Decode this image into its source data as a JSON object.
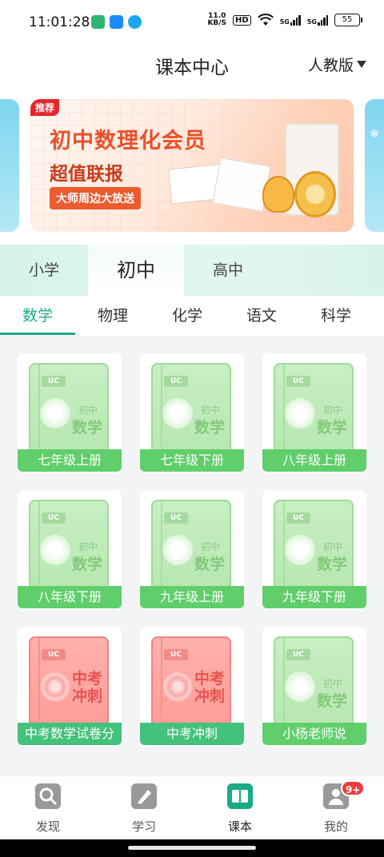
{
  "status_bar": {
    "time": "11:01:28",
    "net_speed_value": "11.0",
    "net_speed_unit": "KB/S",
    "hd": "HD",
    "sig1": "5G",
    "sig2": "5G",
    "battery": "55"
  },
  "header": {
    "title": "课本中心",
    "edition": "人教版"
  },
  "banner": {
    "tag": "推荐",
    "title": "初中数理化会员",
    "subtitle": "超值联报",
    "pill": "大师周边大放送"
  },
  "stage_tabs": [
    "小学",
    "初中",
    "高中"
  ],
  "subject_tabs": [
    "数学",
    "物理",
    "化学",
    "语文",
    "科学"
  ],
  "books": [
    {
      "label": "七年级上册",
      "stage": "初中",
      "subject": "数学",
      "theme": "green"
    },
    {
      "label": "七年级下册",
      "stage": "初中",
      "subject": "数学",
      "theme": "green"
    },
    {
      "label": "八年级上册",
      "stage": "初中",
      "subject": "数学",
      "theme": "green"
    },
    {
      "label": "八年级下册",
      "stage": "初中",
      "subject": "数学",
      "theme": "green"
    },
    {
      "label": "九年级上册",
      "stage": "初中",
      "subject": "数学",
      "theme": "green"
    },
    {
      "label": "九年级下册",
      "stage": "初中",
      "subject": "数学",
      "theme": "green"
    },
    {
      "label": "中考数学试卷分",
      "exam_line1": "中考",
      "exam_line2": "冲刺",
      "theme": "red"
    },
    {
      "label": "中考冲刺",
      "exam_line1": "中考",
      "exam_line2": "冲刺",
      "theme": "red"
    },
    {
      "label": "小杨老师说",
      "stage": "初中",
      "subject": "数学",
      "theme": "green"
    }
  ],
  "bottom_nav": [
    {
      "label": "发现",
      "icon": "discover-icon"
    },
    {
      "label": "学习",
      "icon": "study-icon"
    },
    {
      "label": "课本",
      "icon": "textbook-icon"
    },
    {
      "label": "我的",
      "icon": "profile-icon",
      "badge": "9+"
    }
  ],
  "colors": {
    "accent": "#1aaa86",
    "book_green": "#5fce6b",
    "exam_red": "#f08582",
    "badge_red": "#ef3b3b"
  }
}
